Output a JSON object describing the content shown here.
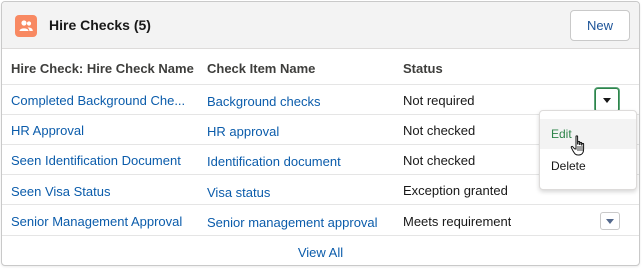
{
  "card": {
    "title": "Hire Checks (5)",
    "icon": "hire-checks-icon",
    "new_label": "New",
    "icon_color": "#f88962"
  },
  "table": {
    "columns": [
      "Hire Check: Hire Check Name",
      "Check Item Name",
      "Status"
    ],
    "rows": [
      {
        "name": "Completed Background Che...",
        "item": "Background checks",
        "status": "Not required"
      },
      {
        "name": "HR Approval",
        "item": "HR approval",
        "status": "Not checked"
      },
      {
        "name": "Seen Identification Document",
        "item": "Identification document",
        "status": "Not checked"
      },
      {
        "name": "Seen Visa Status",
        "item": "Visa status",
        "status": "Exception granted"
      },
      {
        "name": "Senior Management Approval",
        "item": "Senior management approval",
        "status": "Meets requirement"
      }
    ]
  },
  "row_menu": {
    "items": [
      "Edit",
      "Delete"
    ],
    "hovered": "Edit"
  },
  "footer": {
    "view_all": "View All"
  },
  "colors": {
    "link": "#0b5cab",
    "accent_green": "#2e844a"
  }
}
